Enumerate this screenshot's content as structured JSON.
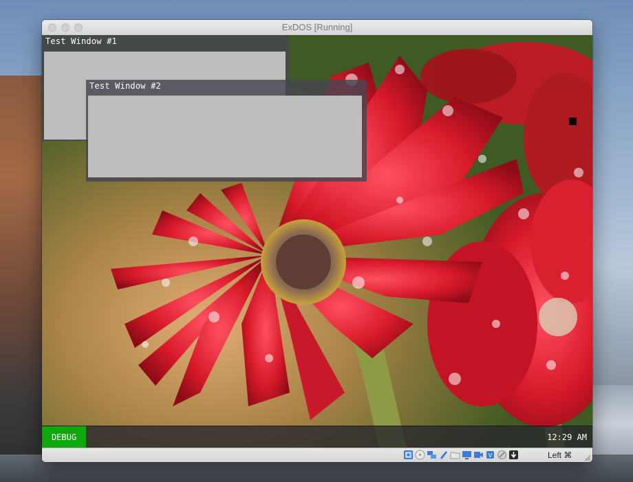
{
  "host_window": {
    "title": "ExDOS [Running]"
  },
  "guest": {
    "windows": [
      {
        "title": "Test Window #1"
      },
      {
        "title": "Test Window #2"
      }
    ],
    "taskbar": {
      "debug_label": "DEBUG",
      "clock": "12:29 AM"
    }
  },
  "statusbar": {
    "icons": [
      "hard-disk-icon",
      "optical-drive-icon",
      "network-icon",
      "usb-icon",
      "shared-folders-icon",
      "display-icon",
      "video-capture-icon",
      "cpu-icon",
      "mouse-integration-icon",
      "keyboard-capture-icon"
    ],
    "host_key": "Left ⌘"
  },
  "colors": {
    "debug_badge": "#0ea80e",
    "guest_window_body": "#bdbdbd",
    "flower_red": "#d81a2a"
  }
}
